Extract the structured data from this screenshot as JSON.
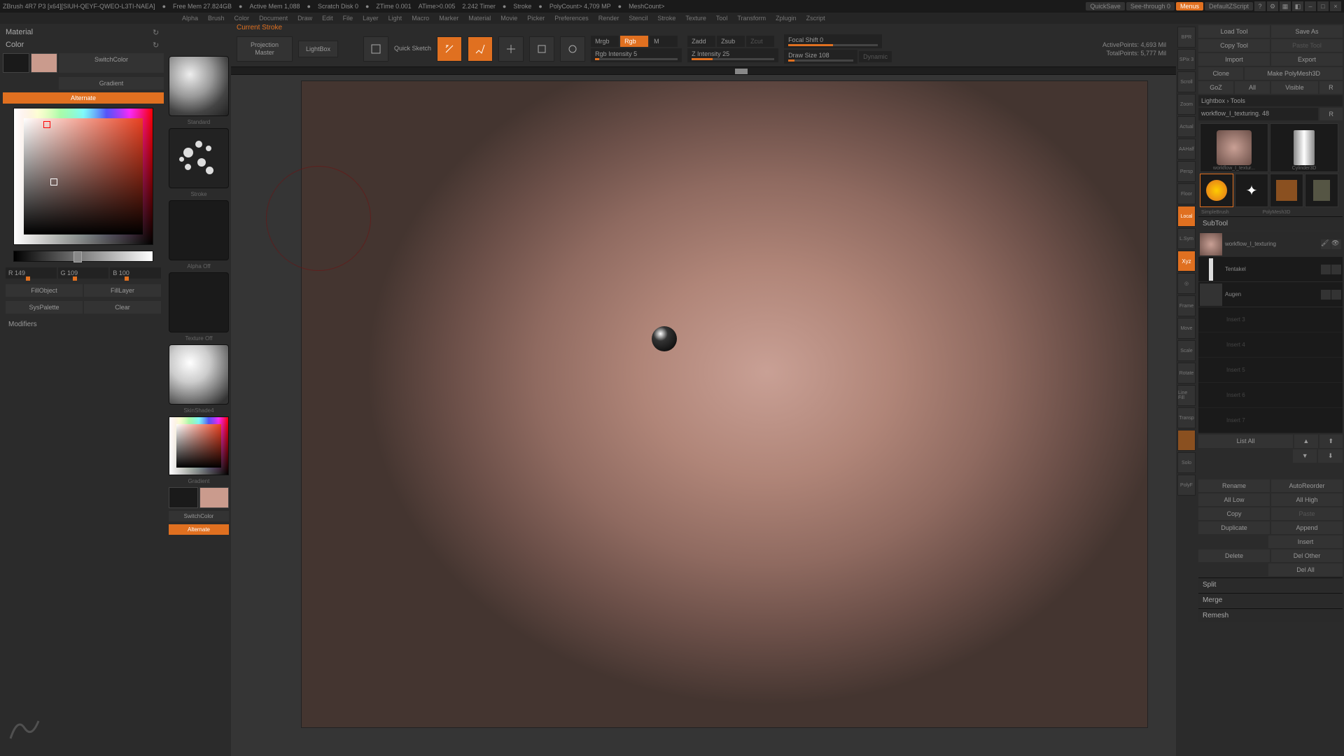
{
  "titlebar": {
    "app": "ZBrush 4R7 P3 [x64][SIUH-QEYF-QWEO-L3TI-NAEA]",
    "free_mem": "Free Mem 27.824GB",
    "active_mem": "Active Mem 1,088",
    "scratch": "Scratch Disk 0",
    "ztime": "ZTime 0.001",
    "atime": "ATime>0.005",
    "timer": "2.242 Timer",
    "stroke": "Stroke",
    "polycount": "PolyCount> 4,709 MP",
    "meshcount": "MeshCount>",
    "quicksave": "QuickSave",
    "seethrough": "See-through 0",
    "menus": "Menus",
    "script": "DefaultZScript"
  },
  "menubar": [
    "Alpha",
    "Brush",
    "Color",
    "Document",
    "Draw",
    "Edit",
    "File",
    "Layer",
    "Light",
    "Macro",
    "Marker",
    "Material",
    "Movie",
    "Picker",
    "Preferences",
    "Render",
    "Stencil",
    "Stroke",
    "Texture",
    "Tool",
    "Transform",
    "Zplugin",
    "Zscript"
  ],
  "left": {
    "material_title": "Material",
    "color_title": "Color",
    "switch_color": "SwitchColor",
    "gradient": "Gradient",
    "alternate": "Alternate",
    "r": "R 149",
    "g": "G 109",
    "b": "B 100",
    "fill_object": "FillObject",
    "fill_layer": "FillLayer",
    "sys_palette": "SysPalette",
    "clear": "Clear",
    "modifiers": "Modifiers",
    "swatch_main": "#ca9b8d",
    "swatch_alt": "#1a1a1a"
  },
  "brush_col": {
    "standard": "Standard",
    "stroke": "Stroke",
    "alpha_off": "Alpha Off",
    "texture_off": "Texture Off",
    "skinshade": "SkinShade4",
    "gradient": "Gradient",
    "switch_color": "SwitchColor",
    "alternate": "Alternate",
    "swatch_main": "#ca9b8d",
    "swatch_alt": "#1a1a1a"
  },
  "topbar": {
    "current_stroke": "Current Stroke",
    "projection_master": "Projection Master",
    "lightbox": "LightBox",
    "quick_sketch": "Quick Sketch",
    "edit": "Edit",
    "draw": "Draw",
    "move": "Move",
    "scale": "Scale",
    "rotate": "Rotate",
    "mrgb": "Mrgb",
    "rgb": "Rgb",
    "m": "M",
    "rgb_intensity": "Rgb Intensity 5",
    "zadd": "Zadd",
    "zsub": "Zsub",
    "zcut": "Zcut",
    "z_intensity": "Z Intensity 25",
    "focal_shift": "Focal Shift 0",
    "draw_size": "Draw Size 108",
    "dynamic": "Dynamic",
    "active_points": "ActivePoints: 4,693 Mil",
    "total_points": "TotalPoints: 5,777 Mil"
  },
  "right_tools": [
    "BPR",
    "SPix 3",
    "Scroll",
    "Zoom",
    "Actual",
    "AAHalf",
    "Persp",
    "Floor",
    "Local",
    "L.Sym",
    "Xyz",
    "",
    "",
    "Frame",
    "Move",
    "Scale",
    "Rotate",
    "Line Fill",
    "",
    "Transp",
    "",
    "",
    "Solo",
    "",
    "PolyF"
  ],
  "right_panel": {
    "load_tool": "Load Tool",
    "save_as": "Save As",
    "copy_tool": "Copy Tool",
    "paste_tool": "Paste Tool",
    "import": "Import",
    "export": "Export",
    "clone": "Clone",
    "make_polymesh": "Make PolyMesh3D",
    "goz": "GoZ",
    "all": "All",
    "visible": "Visible",
    "r": "R",
    "lightbox_tools": "Lightbox › Tools",
    "tool_name": "workflow_I_texturing. 48",
    "thumbs": [
      "workflow_I_textur...",
      "Cylinder3D",
      "SimpleBrush",
      "PolyMesh3D"
    ],
    "subtool": "SubTool",
    "subtools": [
      {
        "name": "workflow_I_texturing",
        "active": true
      },
      {
        "name": "Tentakel",
        "active": false
      },
      {
        "name": "Augen",
        "active": false
      }
    ],
    "empty_slots": [
      "Insert 3",
      "Insert 4",
      "Insert 5",
      "Insert 6",
      "Insert 7"
    ],
    "list_all": "List All",
    "rename": "Rename",
    "auto_reorder": "AutoReorder",
    "all_low": "All Low",
    "all_high": "All High",
    "copy": "Copy",
    "paste": "Paste",
    "duplicate": "Duplicate",
    "append": "Append",
    "insert": "Insert",
    "delete": "Delete",
    "del_other": "Del Other",
    "del_all": "Del All",
    "split": "Split",
    "merge": "Merge",
    "remesh": "Remesh"
  }
}
